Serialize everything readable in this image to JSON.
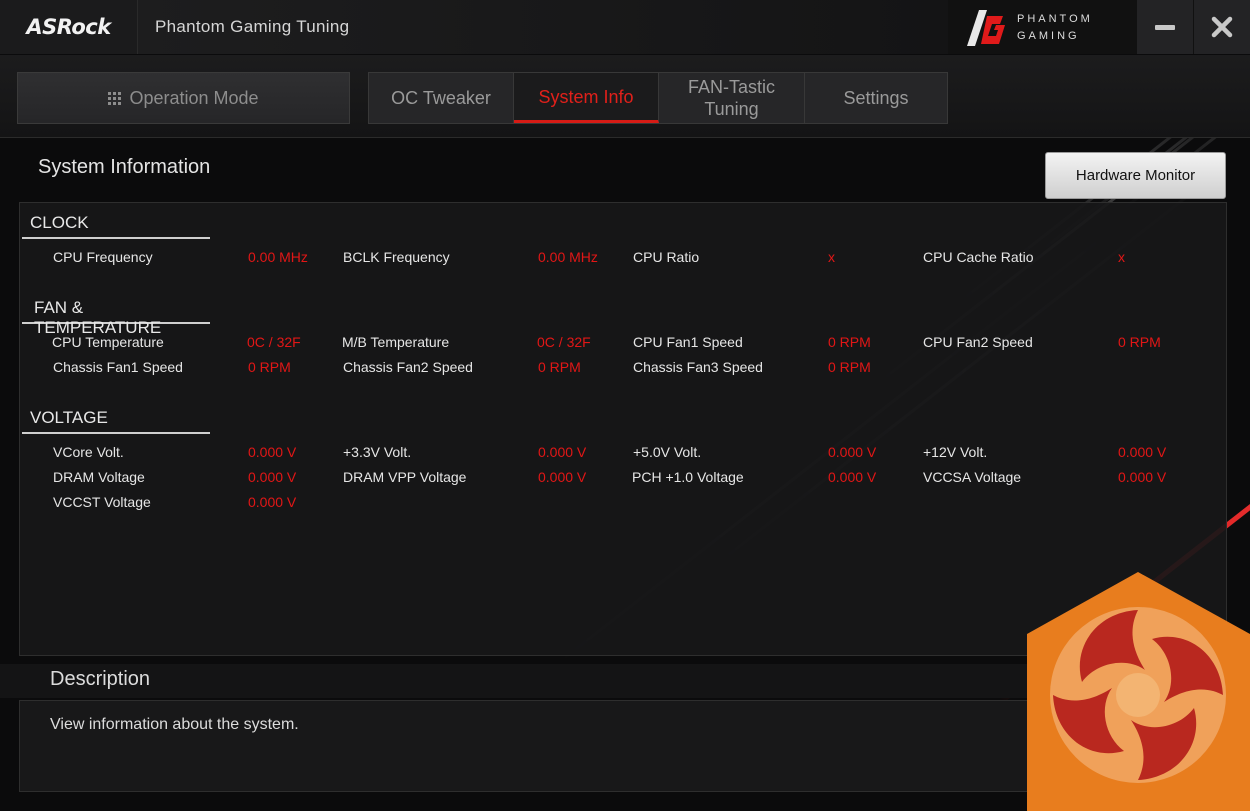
{
  "window": {
    "logo": "ASRock",
    "app_title": "Phantom Gaming Tuning",
    "brand_line1": "PHANTOM",
    "brand_line2": "GAMING"
  },
  "nav": {
    "operation_mode": "Operation Mode",
    "tabs": [
      "OC Tweaker",
      "System Info",
      "FAN-Tastic Tuning",
      "Settings"
    ],
    "active_tab": "System Info"
  },
  "page": {
    "title": "System Information",
    "hardware_monitor_button": "Hardware Monitor"
  },
  "groups": {
    "clock": {
      "title": "CLOCK",
      "items": [
        {
          "label": "CPU Frequency",
          "value": "0.00 MHz"
        },
        {
          "label": "BCLK Frequency",
          "value": "0.00 MHz"
        },
        {
          "label": "CPU Ratio",
          "value": "x"
        },
        {
          "label": "CPU Cache Ratio",
          "value": "x"
        }
      ]
    },
    "fan_temp": {
      "title": "FAN & TEMPERATURE",
      "items": [
        {
          "label": "CPU Temperature",
          "value": "0C / 32F"
        },
        {
          "label": "M/B Temperature",
          "value": "0C / 32F"
        },
        {
          "label": "CPU Fan1 Speed",
          "value": "0 RPM"
        },
        {
          "label": "CPU Fan2 Speed",
          "value": "0 RPM"
        },
        {
          "label": "Chassis Fan1 Speed",
          "value": "0 RPM"
        },
        {
          "label": "Chassis Fan2 Speed",
          "value": "0 RPM"
        },
        {
          "label": "Chassis Fan3 Speed",
          "value": "0 RPM"
        }
      ]
    },
    "voltage": {
      "title": "VOLTAGE",
      "items": [
        {
          "label": "VCore Volt.",
          "value": "0.000 V"
        },
        {
          "label": "+3.3V Volt.",
          "value": "0.000 V"
        },
        {
          "label": "+5.0V Volt.",
          "value": "0.000 V"
        },
        {
          "label": "+12V Volt.",
          "value": "0.000 V"
        },
        {
          "label": "DRAM Voltage",
          "value": "0.000 V"
        },
        {
          "label": "DRAM VPP Voltage",
          "value": "0.000 V"
        },
        {
          "label": "PCH +1.0 Voltage",
          "value": "0.000 V"
        },
        {
          "label": "VCCSA Voltage",
          "value": "0.000 V"
        },
        {
          "label": "VCCST Voltage",
          "value": "0.000 V"
        }
      ]
    }
  },
  "description": {
    "title": "Description",
    "text": "View information about the system."
  },
  "colors": {
    "accent_red": "#e21616",
    "background": "#0b0b0c",
    "panel": "#181819"
  }
}
